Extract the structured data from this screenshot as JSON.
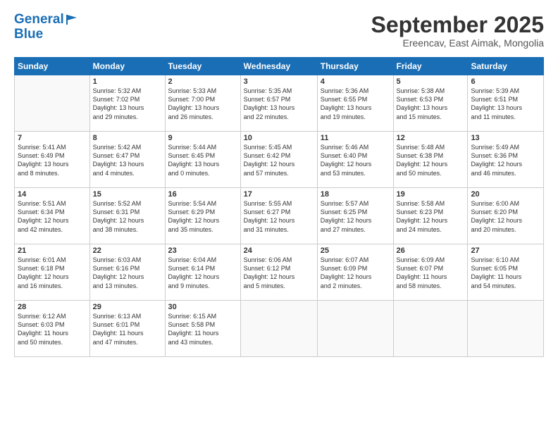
{
  "header": {
    "logo_line1": "General",
    "logo_line2": "Blue",
    "month_title": "September 2025",
    "location": "Ereencav, East Aimak, Mongolia"
  },
  "weekdays": [
    "Sunday",
    "Monday",
    "Tuesday",
    "Wednesday",
    "Thursday",
    "Friday",
    "Saturday"
  ],
  "weeks": [
    [
      {
        "day": "",
        "info": ""
      },
      {
        "day": "1",
        "info": "Sunrise: 5:32 AM\nSunset: 7:02 PM\nDaylight: 13 hours\nand 29 minutes."
      },
      {
        "day": "2",
        "info": "Sunrise: 5:33 AM\nSunset: 7:00 PM\nDaylight: 13 hours\nand 26 minutes."
      },
      {
        "day": "3",
        "info": "Sunrise: 5:35 AM\nSunset: 6:57 PM\nDaylight: 13 hours\nand 22 minutes."
      },
      {
        "day": "4",
        "info": "Sunrise: 5:36 AM\nSunset: 6:55 PM\nDaylight: 13 hours\nand 19 minutes."
      },
      {
        "day": "5",
        "info": "Sunrise: 5:38 AM\nSunset: 6:53 PM\nDaylight: 13 hours\nand 15 minutes."
      },
      {
        "day": "6",
        "info": "Sunrise: 5:39 AM\nSunset: 6:51 PM\nDaylight: 13 hours\nand 11 minutes."
      }
    ],
    [
      {
        "day": "7",
        "info": "Sunrise: 5:41 AM\nSunset: 6:49 PM\nDaylight: 13 hours\nand 8 minutes."
      },
      {
        "day": "8",
        "info": "Sunrise: 5:42 AM\nSunset: 6:47 PM\nDaylight: 13 hours\nand 4 minutes."
      },
      {
        "day": "9",
        "info": "Sunrise: 5:44 AM\nSunset: 6:45 PM\nDaylight: 13 hours\nand 0 minutes."
      },
      {
        "day": "10",
        "info": "Sunrise: 5:45 AM\nSunset: 6:42 PM\nDaylight: 12 hours\nand 57 minutes."
      },
      {
        "day": "11",
        "info": "Sunrise: 5:46 AM\nSunset: 6:40 PM\nDaylight: 12 hours\nand 53 minutes."
      },
      {
        "day": "12",
        "info": "Sunrise: 5:48 AM\nSunset: 6:38 PM\nDaylight: 12 hours\nand 50 minutes."
      },
      {
        "day": "13",
        "info": "Sunrise: 5:49 AM\nSunset: 6:36 PM\nDaylight: 12 hours\nand 46 minutes."
      }
    ],
    [
      {
        "day": "14",
        "info": "Sunrise: 5:51 AM\nSunset: 6:34 PM\nDaylight: 12 hours\nand 42 minutes."
      },
      {
        "day": "15",
        "info": "Sunrise: 5:52 AM\nSunset: 6:31 PM\nDaylight: 12 hours\nand 38 minutes."
      },
      {
        "day": "16",
        "info": "Sunrise: 5:54 AM\nSunset: 6:29 PM\nDaylight: 12 hours\nand 35 minutes."
      },
      {
        "day": "17",
        "info": "Sunrise: 5:55 AM\nSunset: 6:27 PM\nDaylight: 12 hours\nand 31 minutes."
      },
      {
        "day": "18",
        "info": "Sunrise: 5:57 AM\nSunset: 6:25 PM\nDaylight: 12 hours\nand 27 minutes."
      },
      {
        "day": "19",
        "info": "Sunrise: 5:58 AM\nSunset: 6:23 PM\nDaylight: 12 hours\nand 24 minutes."
      },
      {
        "day": "20",
        "info": "Sunrise: 6:00 AM\nSunset: 6:20 PM\nDaylight: 12 hours\nand 20 minutes."
      }
    ],
    [
      {
        "day": "21",
        "info": "Sunrise: 6:01 AM\nSunset: 6:18 PM\nDaylight: 12 hours\nand 16 minutes."
      },
      {
        "day": "22",
        "info": "Sunrise: 6:03 AM\nSunset: 6:16 PM\nDaylight: 12 hours\nand 13 minutes."
      },
      {
        "day": "23",
        "info": "Sunrise: 6:04 AM\nSunset: 6:14 PM\nDaylight: 12 hours\nand 9 minutes."
      },
      {
        "day": "24",
        "info": "Sunrise: 6:06 AM\nSunset: 6:12 PM\nDaylight: 12 hours\nand 5 minutes."
      },
      {
        "day": "25",
        "info": "Sunrise: 6:07 AM\nSunset: 6:09 PM\nDaylight: 12 hours\nand 2 minutes."
      },
      {
        "day": "26",
        "info": "Sunrise: 6:09 AM\nSunset: 6:07 PM\nDaylight: 11 hours\nand 58 minutes."
      },
      {
        "day": "27",
        "info": "Sunrise: 6:10 AM\nSunset: 6:05 PM\nDaylight: 11 hours\nand 54 minutes."
      }
    ],
    [
      {
        "day": "28",
        "info": "Sunrise: 6:12 AM\nSunset: 6:03 PM\nDaylight: 11 hours\nand 50 minutes."
      },
      {
        "day": "29",
        "info": "Sunrise: 6:13 AM\nSunset: 6:01 PM\nDaylight: 11 hours\nand 47 minutes."
      },
      {
        "day": "30",
        "info": "Sunrise: 6:15 AM\nSunset: 5:58 PM\nDaylight: 11 hours\nand 43 minutes."
      },
      {
        "day": "",
        "info": ""
      },
      {
        "day": "",
        "info": ""
      },
      {
        "day": "",
        "info": ""
      },
      {
        "day": "",
        "info": ""
      }
    ]
  ]
}
